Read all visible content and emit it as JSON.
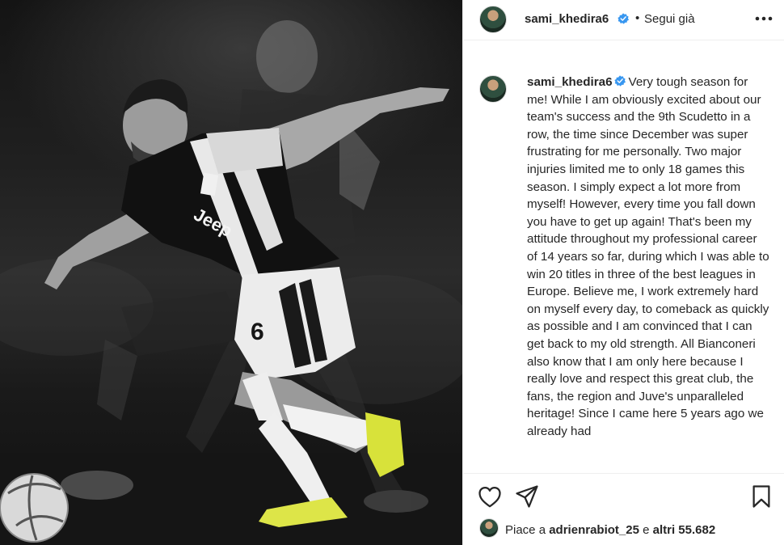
{
  "photo": {
    "alt_icons": [
      "football-player",
      "soccer-ball"
    ],
    "jersey_brand": "Jeep",
    "jersey_number": "6"
  },
  "post": {
    "username": "sami_khedira6",
    "separator": "•",
    "follow_status": "Segui già",
    "more_icon": "more-horizontal-icon",
    "caption": "Very tough season for me! While I am obviously excited about our team's success and the 9th Scudetto in a row, the time since December was super frustrating for me personally. Two major injuries limited me to only 18 games this season. I simply expect a lot more from myself! However, every time you fall down you have to get up again! That's been my attitude throughout my professional career of 14 years so far, during which I was able to win 20 titles in three of the best leagues in Europe. Believe me, I work extremely hard on myself every day, to comeback as quickly as possible and I am convinced that I can get back to my old strength. All Bianconeri also know that I am only here because I really love and respect this great club, the fans, the region and Juve's unparalleled heritage! Since I came here 5 years ago we already had",
    "likes_prefix": "Piace a",
    "likes_user": "adrienrabiot_25",
    "likes_and": "e",
    "likes_count": "altri 55.682"
  },
  "colors": {
    "verified_blue": "#3897f0",
    "text": "#262626",
    "divider": "#efefef"
  }
}
